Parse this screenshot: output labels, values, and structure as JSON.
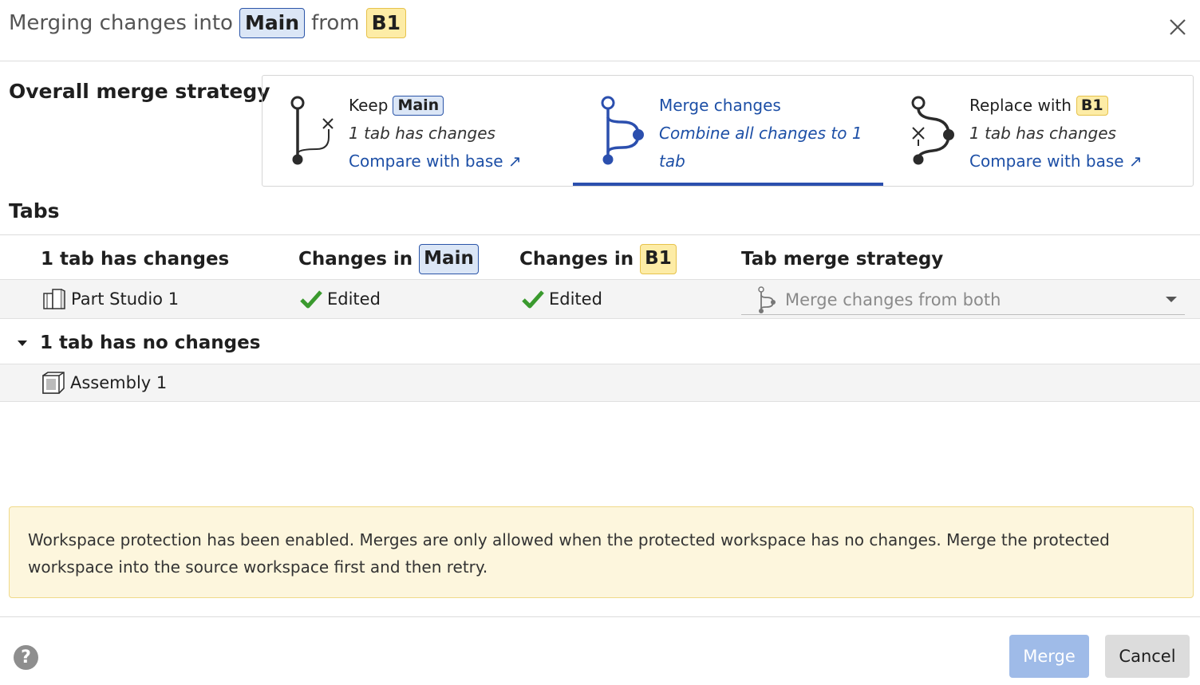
{
  "header": {
    "prefix": "Merging changes into",
    "target": "Main",
    "mid": "from",
    "source": "B1"
  },
  "strategy": {
    "title": "Overall merge strategy",
    "options": [
      {
        "label": "Keep",
        "badge": "Main",
        "sub": "1 tab has changes",
        "link": "Compare with base ↗",
        "selected": false
      },
      {
        "label": "Merge changes",
        "sub_line1": "Combine all changes to 1",
        "sub_line2": "tab",
        "selected": true
      },
      {
        "label": "Replace with",
        "badge": "B1",
        "sub": "1 tab has changes",
        "link": "Compare with base ↗",
        "selected": false
      }
    ]
  },
  "tabs": {
    "title": "Tabs",
    "columns": {
      "changed_count": "1 tab has changes",
      "changes_in": "Changes in",
      "main": "Main",
      "b1": "B1",
      "strategy": "Tab merge strategy"
    },
    "changed_rows": [
      {
        "name": "Part Studio 1",
        "main_change": "Edited",
        "b1_change": "Edited",
        "strategy": "Merge changes from both"
      }
    ],
    "unchanged_group": "1 tab has no changes",
    "unchanged_rows": [
      {
        "name": "Assembly 1"
      }
    ]
  },
  "warning": "Workspace protection has been enabled. Merges are only allowed when the protected workspace has no changes. Merge the protected workspace into the source workspace first and then retry.",
  "footer": {
    "help": "?",
    "merge": "Merge",
    "cancel": "Cancel"
  },
  "colors": {
    "accent": "#2b4fae",
    "link": "#1d4fa6",
    "main_badge_bg": "#dbe6f6",
    "b1_badge_bg": "#fdeca6",
    "warning_bg": "#fdf6dd",
    "edited_check": "#3a9a2e",
    "merge_button": "#9fbbe8"
  }
}
